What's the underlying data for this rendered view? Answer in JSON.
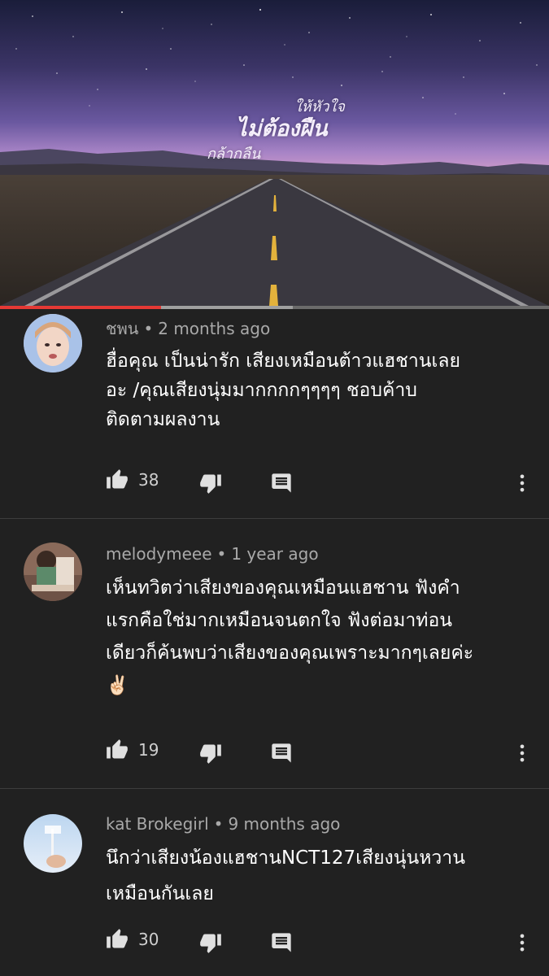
{
  "video": {
    "title_line1": "ให้หัวใจ",
    "title_line2": "ไม่ต้องฝืน",
    "title_line3": "กล้ากลืน",
    "progress_fraction": 0.294
  },
  "comments": [
    {
      "author": "ชพน",
      "time": "2 months ago",
      "lines": [
        "ฮื่อคุณ เป็นน่ารัก เสียงเหมือนต้าวแฮชานเลย",
        "อะ /คุณเสียงนุ่มมากกกกๆๆๆๆ ชอบค้าบ",
        "ติดตามผลงาน"
      ],
      "likes": "38"
    },
    {
      "author": "melodymeee",
      "time": "1 year ago",
      "lines": [
        "เห็นทวิตว่าเสียงของคุณเหมือนแฮชาน ฟังคำ",
        "แรกคือใช่มากเหมือนจนตกใจ ฟังต่อมาท่อน",
        "เดียวก็ค้นพบว่าเสียงของคุณเพราะมากๆเลยค่ะ",
        "✌🏻"
      ],
      "likes": "19"
    },
    {
      "author": "kat Brokegirl",
      "time": "9 months ago",
      "lines": [
        "นึกว่าเสียงน้องแฮชานNCT127เสียงนุ่นหวาน",
        "เหมือนกันเลย"
      ],
      "likes": "30"
    }
  ],
  "separator": "•",
  "icons": {
    "like": "thumbs-up-icon",
    "dislike": "thumbs-down-icon",
    "reply": "reply-comment-icon",
    "more": "more-vertical-icon"
  },
  "colors": {
    "progress": "#e53935",
    "background": "#212121"
  }
}
